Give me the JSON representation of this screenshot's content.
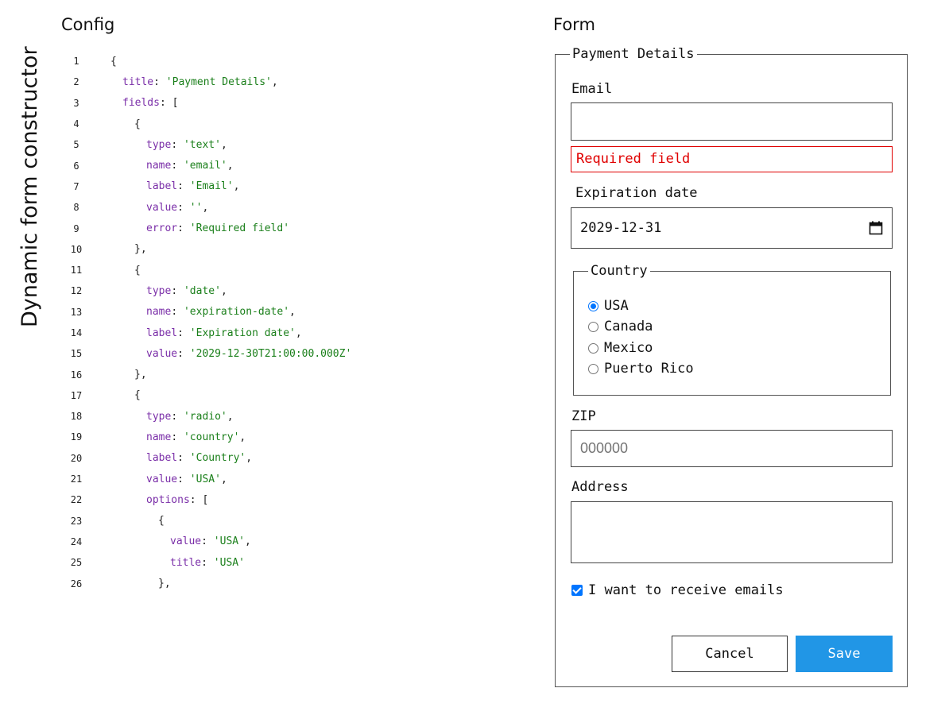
{
  "page": {
    "side_title": "Dynamic form constructor",
    "config_heading": "Config",
    "form_heading": "Form"
  },
  "config": {
    "lines": [
      {
        "n": "1",
        "tokens": [
          {
            "t": "pun",
            "v": "{"
          }
        ],
        "indent": 0
      },
      {
        "n": "2",
        "tokens": [
          {
            "t": "key",
            "v": "title"
          },
          {
            "t": "pun",
            "v": ": "
          },
          {
            "t": "str",
            "v": "'Payment Details'"
          },
          {
            "t": "pun",
            "v": ","
          }
        ],
        "indent": 1
      },
      {
        "n": "3",
        "tokens": [
          {
            "t": "key",
            "v": "fields"
          },
          {
            "t": "pun",
            "v": ": ["
          }
        ],
        "indent": 1
      },
      {
        "n": "4",
        "tokens": [
          {
            "t": "pun",
            "v": "{"
          }
        ],
        "indent": 2
      },
      {
        "n": "5",
        "tokens": [
          {
            "t": "key",
            "v": "type"
          },
          {
            "t": "pun",
            "v": ": "
          },
          {
            "t": "str",
            "v": "'text'"
          },
          {
            "t": "pun",
            "v": ","
          }
        ],
        "indent": 3
      },
      {
        "n": "6",
        "tokens": [
          {
            "t": "key",
            "v": "name"
          },
          {
            "t": "pun",
            "v": ": "
          },
          {
            "t": "str",
            "v": "'email'"
          },
          {
            "t": "pun",
            "v": ","
          }
        ],
        "indent": 3
      },
      {
        "n": "7",
        "tokens": [
          {
            "t": "key",
            "v": "label"
          },
          {
            "t": "pun",
            "v": ": "
          },
          {
            "t": "str",
            "v": "'Email'"
          },
          {
            "t": "pun",
            "v": ","
          }
        ],
        "indent": 3
      },
      {
        "n": "8",
        "tokens": [
          {
            "t": "key",
            "v": "value"
          },
          {
            "t": "pun",
            "v": ": "
          },
          {
            "t": "str",
            "v": "''"
          },
          {
            "t": "pun",
            "v": ","
          }
        ],
        "indent": 3
      },
      {
        "n": "9",
        "tokens": [
          {
            "t": "key",
            "v": "error"
          },
          {
            "t": "pun",
            "v": ": "
          },
          {
            "t": "str",
            "v": "'Required field'"
          }
        ],
        "indent": 3
      },
      {
        "n": "10",
        "tokens": [
          {
            "t": "pun",
            "v": "},"
          }
        ],
        "indent": 2
      },
      {
        "n": "11",
        "tokens": [
          {
            "t": "pun",
            "v": "{"
          }
        ],
        "indent": 2
      },
      {
        "n": "12",
        "tokens": [
          {
            "t": "key",
            "v": "type"
          },
          {
            "t": "pun",
            "v": ": "
          },
          {
            "t": "str",
            "v": "'date'"
          },
          {
            "t": "pun",
            "v": ","
          }
        ],
        "indent": 3
      },
      {
        "n": "13",
        "tokens": [
          {
            "t": "key",
            "v": "name"
          },
          {
            "t": "pun",
            "v": ": "
          },
          {
            "t": "str",
            "v": "'expiration-date'"
          },
          {
            "t": "pun",
            "v": ","
          }
        ],
        "indent": 3
      },
      {
        "n": "14",
        "tokens": [
          {
            "t": "key",
            "v": "label"
          },
          {
            "t": "pun",
            "v": ": "
          },
          {
            "t": "str",
            "v": "'Expiration date'"
          },
          {
            "t": "pun",
            "v": ","
          }
        ],
        "indent": 3
      },
      {
        "n": "15",
        "tokens": [
          {
            "t": "key",
            "v": "value"
          },
          {
            "t": "pun",
            "v": ": "
          },
          {
            "t": "str",
            "v": "'2029-12-30T21:00:00.000Z'"
          }
        ],
        "indent": 3
      },
      {
        "n": "16",
        "tokens": [
          {
            "t": "pun",
            "v": "},"
          }
        ],
        "indent": 2
      },
      {
        "n": "17",
        "tokens": [
          {
            "t": "pun",
            "v": "{"
          }
        ],
        "indent": 2
      },
      {
        "n": "18",
        "tokens": [
          {
            "t": "key",
            "v": "type"
          },
          {
            "t": "pun",
            "v": ": "
          },
          {
            "t": "str",
            "v": "'radio'"
          },
          {
            "t": "pun",
            "v": ","
          }
        ],
        "indent": 3
      },
      {
        "n": "19",
        "tokens": [
          {
            "t": "key",
            "v": "name"
          },
          {
            "t": "pun",
            "v": ": "
          },
          {
            "t": "str",
            "v": "'country'"
          },
          {
            "t": "pun",
            "v": ","
          }
        ],
        "indent": 3
      },
      {
        "n": "20",
        "tokens": [
          {
            "t": "key",
            "v": "label"
          },
          {
            "t": "pun",
            "v": ": "
          },
          {
            "t": "str",
            "v": "'Country'"
          },
          {
            "t": "pun",
            "v": ","
          }
        ],
        "indent": 3
      },
      {
        "n": "21",
        "tokens": [
          {
            "t": "key",
            "v": "value"
          },
          {
            "t": "pun",
            "v": ": "
          },
          {
            "t": "str",
            "v": "'USA'"
          },
          {
            "t": "pun",
            "v": ","
          }
        ],
        "indent": 3
      },
      {
        "n": "22",
        "tokens": [
          {
            "t": "key",
            "v": "options"
          },
          {
            "t": "pun",
            "v": ": ["
          }
        ],
        "indent": 3
      },
      {
        "n": "23",
        "tokens": [
          {
            "t": "pun",
            "v": "{"
          }
        ],
        "indent": 4
      },
      {
        "n": "24",
        "tokens": [
          {
            "t": "key",
            "v": "value"
          },
          {
            "t": "pun",
            "v": ": "
          },
          {
            "t": "str",
            "v": "'USA'"
          },
          {
            "t": "pun",
            "v": ","
          }
        ],
        "indent": 5
      },
      {
        "n": "25",
        "tokens": [
          {
            "t": "key",
            "v": "title"
          },
          {
            "t": "pun",
            "v": ": "
          },
          {
            "t": "str",
            "v": "'USA'"
          }
        ],
        "indent": 5
      },
      {
        "n": "26",
        "tokens": [
          {
            "t": "pun",
            "v": "},"
          }
        ],
        "indent": 4
      }
    ]
  },
  "form": {
    "legend": "Payment Details",
    "email": {
      "label": "Email",
      "value": "",
      "error": "Required field"
    },
    "expiration": {
      "label": "Expiration date",
      "value": "2029-12-31",
      "icon": "calendar-icon"
    },
    "country": {
      "legend": "Country",
      "options": [
        {
          "title": "USA",
          "selected": true
        },
        {
          "title": "Canada",
          "selected": false
        },
        {
          "title": "Mexico",
          "selected": false
        },
        {
          "title": "Puerto Rico",
          "selected": false
        }
      ]
    },
    "zip": {
      "label": "ZIP",
      "placeholder": "000000"
    },
    "address": {
      "label": "Address",
      "value": ""
    },
    "subscribe": {
      "label": "I want to receive emails",
      "checked": true
    },
    "buttons": {
      "cancel": "Cancel",
      "save": "Save"
    }
  },
  "colors": {
    "accent": "#0075ff",
    "save_button": "#2196e6",
    "error": "#e00000",
    "code_key": "#7a2ea8",
    "code_string": "#1a7f1a"
  }
}
